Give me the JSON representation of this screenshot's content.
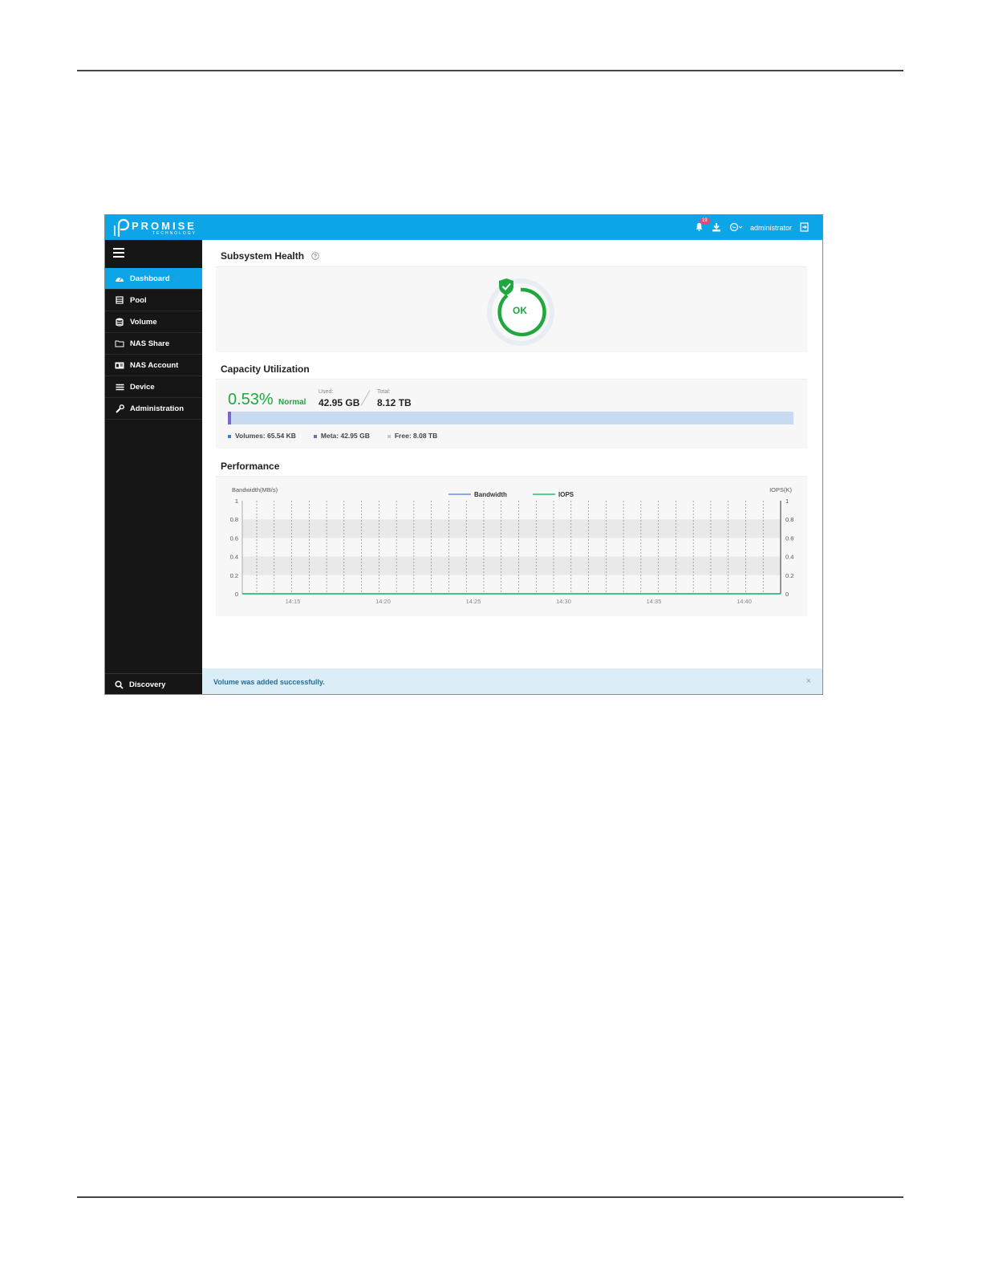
{
  "header": {
    "brand": "PROMISE",
    "brand_sub": "TECHNOLOGY",
    "notification_count": "19",
    "user": "administrator",
    "icons": [
      "bell-icon",
      "download-icon",
      "chat-icon",
      "logout-icon"
    ]
  },
  "sidebar": {
    "items": [
      {
        "label": "Dashboard",
        "icon": "dashboard-icon",
        "active": true
      },
      {
        "label": "Pool",
        "icon": "pool-icon"
      },
      {
        "label": "Volume",
        "icon": "volume-icon"
      },
      {
        "label": "NAS Share",
        "icon": "folder-icon"
      },
      {
        "label": "NAS Account",
        "icon": "account-icon"
      },
      {
        "label": "Device",
        "icon": "device-icon"
      },
      {
        "label": "Administration",
        "icon": "wrench-icon"
      }
    ],
    "discovery": "Discovery"
  },
  "health": {
    "title": "Subsystem Health",
    "status": "OK",
    "colors": {
      "ok": "#1ea83f"
    }
  },
  "capacity": {
    "title": "Capacity Utilization",
    "percent": "0.53%",
    "percent_value": 0.53,
    "state": "Normal",
    "used_label": "Used:",
    "used": "42.95 GB",
    "total_label": "Total:",
    "total": "8.12 TB",
    "legend": [
      {
        "label": "Volumes: 65.54 KB",
        "color": "#3b7fd9"
      },
      {
        "label": "Meta: 42.95 GB",
        "color": "#7b68c6"
      },
      {
        "label": "Free: 8.08 TB",
        "color": "#c8c8c8"
      }
    ]
  },
  "performance": {
    "title": "Performance"
  },
  "chart_data": {
    "type": "line",
    "ylabel": "Bandwidth(MB/s)",
    "y2label": "IOPS(K)",
    "ylim": [
      0,
      1
    ],
    "y2lim": [
      0,
      1
    ],
    "yticks": [
      "0",
      "0.2",
      "0.4",
      "0.6",
      "0.8",
      "1"
    ],
    "xticks": [
      "14:15",
      "14:20",
      "14:25",
      "14:30",
      "14:35",
      "14:40"
    ],
    "legend_position": "top-center",
    "series": [
      {
        "name": "Bandwidth",
        "color": "#6f8fe0",
        "values": [
          0,
          0,
          0,
          0,
          0,
          0,
          0,
          0,
          0,
          0,
          0,
          0,
          0,
          0,
          0,
          0,
          0,
          0,
          0,
          0,
          0,
          0,
          0,
          0,
          0,
          0,
          0,
          0,
          0,
          0
        ]
      },
      {
        "name": "IOPS",
        "color": "#1ec26a",
        "values": [
          0,
          0,
          0,
          0,
          0,
          0,
          0,
          0,
          0,
          0,
          0,
          0,
          0,
          0,
          0,
          0,
          0,
          0,
          0,
          0,
          0,
          0,
          0,
          0,
          0,
          0,
          0,
          0,
          0,
          0
        ]
      }
    ]
  },
  "toast": {
    "message": "Volume was added successfully.",
    "close": "×"
  }
}
